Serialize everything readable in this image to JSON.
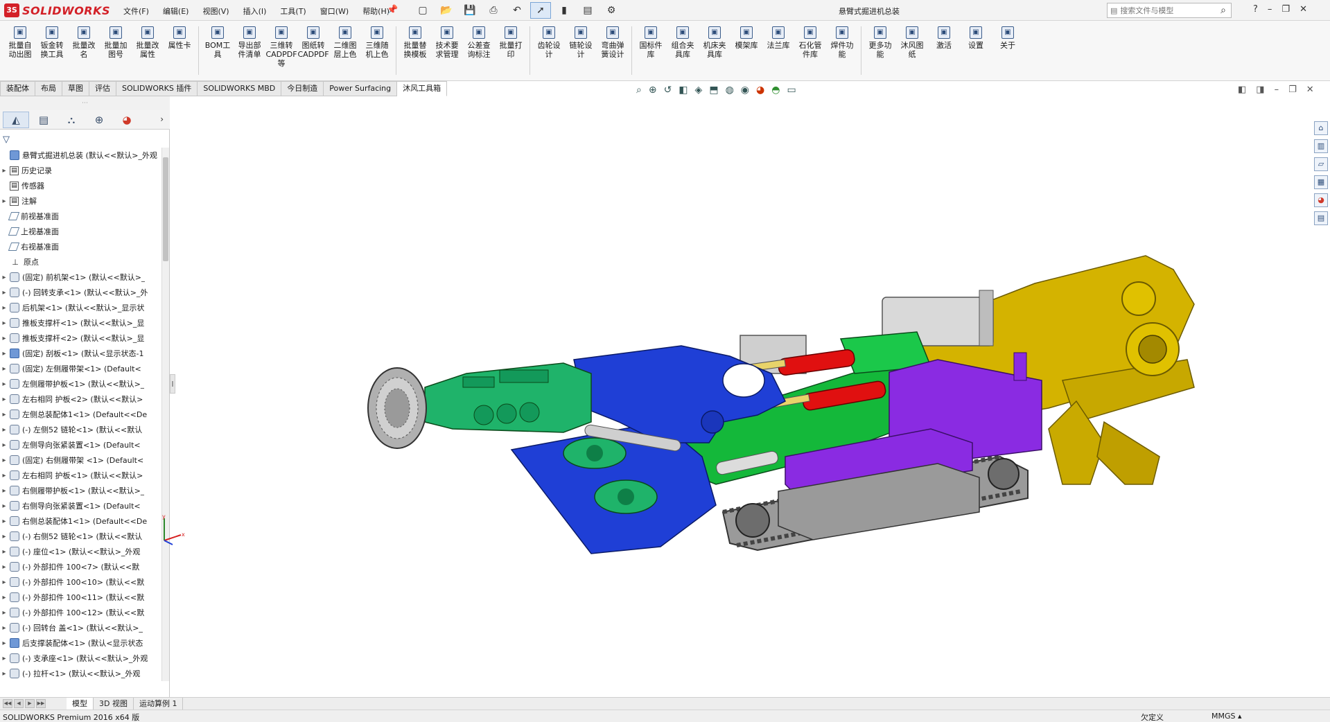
{
  "app": {
    "brand_mark": "3S",
    "brand_name": "SOLIDWORKS",
    "document_title": "悬臂式掘进机总装",
    "search_placeholder": "搜索文件与模型"
  },
  "menus": [
    "文件(F)",
    "编辑(E)",
    "视图(V)",
    "插入(I)",
    "工具(T)",
    "窗口(W)",
    "帮助(H)"
  ],
  "quick_access_icons": [
    "new-file-icon",
    "open-file-icon",
    "save-icon",
    "print-icon",
    "undo-icon",
    "select-arrow-icon",
    "rebuild-icon",
    "file-properties-icon",
    "options-gear-icon"
  ],
  "window_controls": [
    "help-icon",
    "minimize-icon",
    "restore-icon",
    "close-icon"
  ],
  "command_tools": [
    {
      "label": "批量自\n动出图",
      "icon": "batch-drawing-icon"
    },
    {
      "label": "钣金转\n换工具",
      "icon": "sheetmetal-icon"
    },
    {
      "label": "批量改\n名",
      "icon": "rename-icon"
    },
    {
      "label": "批量加\n图号",
      "icon": "number-icon"
    },
    {
      "label": "批量改\n属性",
      "icon": "attribute-icon"
    },
    {
      "label": "属性卡",
      "icon": "property-card-icon"
    },
    {
      "label": "BOM工\n具",
      "icon": "bom-icon"
    },
    {
      "label": "导出部\n件清单",
      "icon": "export-list-icon"
    },
    {
      "label": "三维转\nCADPDF\n等",
      "icon": "convert-3d-icon"
    },
    {
      "label": "图纸转\nCADPDF",
      "icon": "convert-drawing-icon"
    },
    {
      "label": "二维图\n层上色",
      "icon": "layer-color-icon"
    },
    {
      "label": "三维随\n机上色",
      "icon": "random-color-icon"
    },
    {
      "label": "批量替\n换模板",
      "icon": "replace-template-icon"
    },
    {
      "label": "技术要\n求管理",
      "icon": "tech-requirement-icon"
    },
    {
      "label": "公差查\n询标注",
      "icon": "tolerance-icon"
    },
    {
      "label": "批量打\n印",
      "icon": "batch-print-icon"
    },
    {
      "label": "齿轮设\n计",
      "icon": "gear-design-icon"
    },
    {
      "label": "链轮设\n计",
      "icon": "sprocket-design-icon"
    },
    {
      "label": "弯曲弹\n簧设计",
      "icon": "spring-design-icon"
    },
    {
      "label": "国标件\n库",
      "icon": "standard-parts-icon"
    },
    {
      "label": "组合夹\n具库",
      "icon": "fixture-library-icon"
    },
    {
      "label": "机床夹\n具库",
      "icon": "machine-fixture-icon"
    },
    {
      "label": "模架库",
      "icon": "mold-base-icon"
    },
    {
      "label": "法兰库",
      "icon": "flange-library-icon"
    },
    {
      "label": "石化管\n件库",
      "icon": "pipe-fitting-icon"
    },
    {
      "label": "焊件功\n能",
      "icon": "weldment-icon"
    },
    {
      "label": "更多功\n能",
      "icon": "more-functions-icon"
    },
    {
      "label": "沐风图\n纸",
      "icon": "mufeng-drawing-icon"
    },
    {
      "label": "激活",
      "icon": "activate-icon"
    },
    {
      "label": "设置",
      "icon": "settings-icon"
    },
    {
      "label": "关于",
      "icon": "about-icon"
    }
  ],
  "ribbon_tabs": [
    {
      "label": "装配体",
      "active": false
    },
    {
      "label": "布局",
      "active": false
    },
    {
      "label": "草图",
      "active": false
    },
    {
      "label": "评估",
      "active": false
    },
    {
      "label": "SOLIDWORKS 插件",
      "active": false
    },
    {
      "label": "SOLIDWORKS MBD",
      "active": false
    },
    {
      "label": "今日制造",
      "active": false
    },
    {
      "label": "Power Surfacing",
      "active": false
    },
    {
      "label": "沐风工具箱",
      "active": true
    }
  ],
  "heads_up_icons": [
    "zoom-to-fit-icon",
    "zoom-area-icon",
    "previous-view-icon",
    "section-view-icon",
    "dynamic-annotation-icon",
    "view-orientation-icon",
    "display-style-icon",
    "hide-show-icon",
    "edit-appearance-icon",
    "scene-icon",
    "view-settings-icon"
  ],
  "panel_tabs": [
    "feature-manager-icon",
    "property-manager-icon",
    "configuration-manager-icon",
    "dimxpert-icon",
    "display-manager-icon"
  ],
  "feature_tree": [
    {
      "text": "悬臂式掘进机总装  (默认<<默认>_外观",
      "icon": "asm",
      "expand": "",
      "top": true
    },
    {
      "text": "历史记录",
      "icon": "box",
      "expand": "▸"
    },
    {
      "text": "传感器",
      "icon": "box",
      "expand": ""
    },
    {
      "text": "注解",
      "icon": "box",
      "expand": "▸"
    },
    {
      "text": "前视基准面",
      "icon": "plane",
      "expand": ""
    },
    {
      "text": "上视基准面",
      "icon": "plane",
      "expand": ""
    },
    {
      "text": "右视基准面",
      "icon": "plane",
      "expand": ""
    },
    {
      "text": "原点",
      "icon": "origin",
      "expand": ""
    },
    {
      "text": "(固定) 前机架<1> (默认<<默认>_",
      "icon": "part",
      "expand": "▸"
    },
    {
      "text": "(-) 回转支承<1> (默认<<默认>_外",
      "icon": "part",
      "expand": "▸"
    },
    {
      "text": "后机架<1> (默认<<默认>_显示状",
      "icon": "part",
      "expand": "▸"
    },
    {
      "text": "推板支撑杆<1> (默认<<默认>_显",
      "icon": "part",
      "expand": "▸"
    },
    {
      "text": "推板支撑杆<2> (默认<<默认>_显",
      "icon": "part",
      "expand": "▸"
    },
    {
      "text": "(固定) 刮板<1> (默认<显示状态-1",
      "icon": "asm",
      "expand": "▸"
    },
    {
      "text": "(固定) 左侧履带架<1> (Default<",
      "icon": "part",
      "expand": "▸"
    },
    {
      "text": "左侧履带护板<1> (默认<<默认>_",
      "icon": "part",
      "expand": "▸"
    },
    {
      "text": "左右相同  护板<2> (默认<<默认>",
      "icon": "part",
      "expand": "▸"
    },
    {
      "text": "左侧总装配体1<1> (Default<<De",
      "icon": "part",
      "expand": "▸"
    },
    {
      "text": "(-) 左侧52  链轮<1> (默认<<默认",
      "icon": "part",
      "expand": "▸"
    },
    {
      "text": "左侧导向张紧装置<1> (Default<",
      "icon": "part",
      "expand": "▸"
    },
    {
      "text": "(固定) 右侧履带架 <1> (Default<",
      "icon": "part",
      "expand": "▸"
    },
    {
      "text": "左右相同  护板<1> (默认<<默认>",
      "icon": "part",
      "expand": "▸"
    },
    {
      "text": "右侧履带护板<1> (默认<<默认>_",
      "icon": "part",
      "expand": "▸"
    },
    {
      "text": "右侧导向张紧装置<1> (Default<",
      "icon": "part",
      "expand": "▸"
    },
    {
      "text": "右侧总装配体1<1> (Default<<De",
      "icon": "part",
      "expand": "▸"
    },
    {
      "text": "(-) 右侧52  链轮<1> (默认<<默认",
      "icon": "part",
      "expand": "▸"
    },
    {
      "text": "(-) 座位<1> (默认<<默认>_外观",
      "icon": "part",
      "expand": "▸"
    },
    {
      "text": "(-) 外部扣件  100<7> (默认<<默",
      "icon": "part",
      "expand": "▸"
    },
    {
      "text": "(-) 外部扣件  100<10> (默认<<默",
      "icon": "part",
      "expand": "▸"
    },
    {
      "text": "(-) 外部扣件  100<11> (默认<<默",
      "icon": "part",
      "expand": "▸"
    },
    {
      "text": "(-) 外部扣件  100<12> (默认<<默",
      "icon": "part",
      "expand": "▸"
    },
    {
      "text": "(-) 回转台 盖<1> (默认<<默认>_",
      "icon": "part",
      "expand": "▸"
    },
    {
      "text": "后支撑装配体<1> (默认<显示状态",
      "icon": "asm",
      "expand": "▸"
    },
    {
      "text": "(-) 支承座<1> (默认<<默认>_外观",
      "icon": "part",
      "expand": "▸"
    },
    {
      "text": "(-) 拉杆<1> (默认<<默认>_外观",
      "icon": "part",
      "expand": "▸"
    }
  ],
  "bottom_tabs": [
    {
      "label": "模型",
      "active": true
    },
    {
      "label": "3D 视图",
      "active": false
    },
    {
      "label": "运动算例 1",
      "active": false
    }
  ],
  "status": {
    "left": "SOLIDWORKS Premium 2016 x64 版",
    "definition": "欠定义",
    "units": "MMGS  ▴"
  },
  "task_pane_icons": [
    "home-icon",
    "design-library-icon",
    "file-explorer-icon",
    "view-palette-icon",
    "appearances-icon",
    "custom-properties-icon"
  ],
  "triad": {
    "x": "x",
    "y": "y",
    "z": "z"
  },
  "colors": {
    "brand_red": "#d32027",
    "cutter_green": "#1fb36a",
    "boom_blue": "#1f3fd6",
    "body_purple": "#8a2be2",
    "frame_yellow": "#d4b300",
    "cylinder_red": "#e01010",
    "track_gray": "#8c8c8c"
  }
}
